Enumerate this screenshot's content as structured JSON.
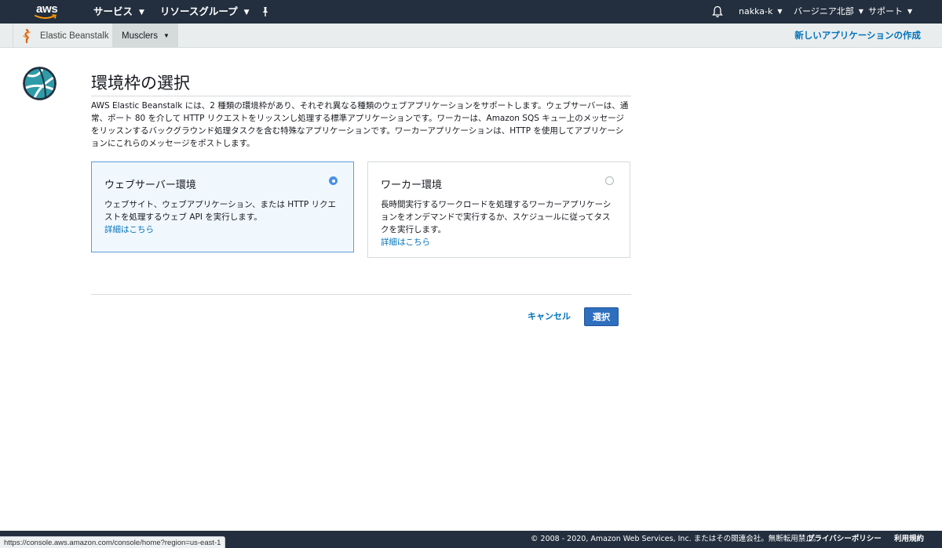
{
  "topnav": {
    "logo_text": "aws",
    "services_label": "サービス",
    "resource_groups_label": "リソースグループ",
    "user_label": "nakka-k",
    "region_label": "バージニア北部",
    "support_label": "サポート",
    "icons": [
      "pin-icon",
      "bell-icon",
      "chevron-down-icon"
    ]
  },
  "subbar": {
    "service_name": "Elastic Beanstalk",
    "app_name": "Musclers",
    "create_app_label": "新しいアプリケーションの作成"
  },
  "main": {
    "title": "環境枠の選択",
    "description": "AWS Elastic Beanstalk には、2 種類の環境枠があり、それぞれ異なる種類のウェブアプリケーションをサポートします。ウェブサーバーは、通常、ポート 80 を介して HTTP リクエストをリッスンし処理する標準アプリケーションです。ワーカーは、Amazon SQS キュー上のメッセージをリッスンするバックグラウンド処理タスクを含む特殊なアプリケーションです。ワーカーアプリケーションは、HTTP を使用してアプリケーションにこれらのメッセージをポストします。",
    "tiers": [
      {
        "title": "ウェブサーバー環境",
        "description": "ウェブサイト、ウェブアプリケーション、または HTTP リクエストを処理するウェブ API を実行します。",
        "link": "詳細はこちら",
        "selected": true
      },
      {
        "title": "ワーカー環境",
        "description": "長時間実行するワークロードを処理するワーカーアプリケーションをオンデマンドで実行するか、スケジュールに従ってタスクを実行します。",
        "link": "詳細はこちら",
        "selected": false
      }
    ],
    "cancel_label": "キャンセル",
    "select_label": "選択"
  },
  "footer": {
    "copyright": "© 2008 - 2020, Amazon Web Services, Inc. またはその関連会社。無断転用禁止。",
    "privacy_label": "プライバシーポリシー",
    "terms_label": "利用規約"
  },
  "status_bar": {
    "url": "https://console.aws.amazon.com/console/home?region=us-east-1"
  },
  "colors": {
    "nav_background": "#232f3e",
    "link": "#0073bb",
    "primary_button": "#2e6fbf",
    "selected_card_border": "#5e9bd6",
    "selected_card_background": "#f1f8fd"
  }
}
